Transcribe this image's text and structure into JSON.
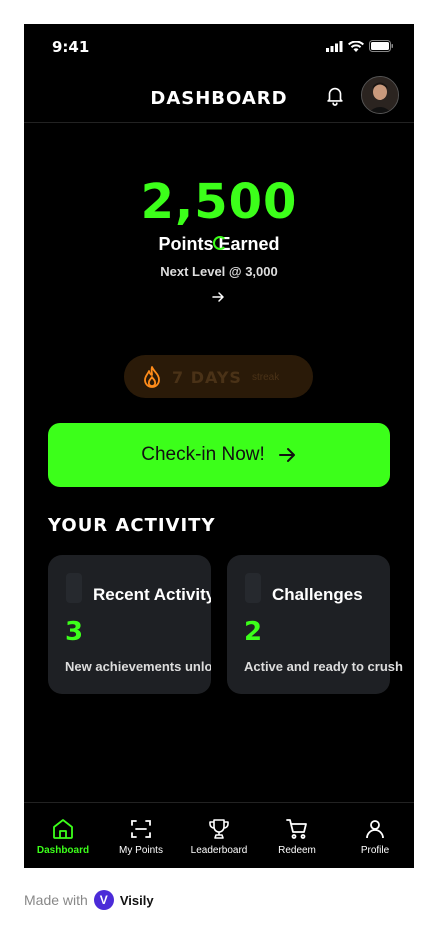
{
  "status_bar": {
    "time": "9:41"
  },
  "header": {
    "title": "DASHBOARD"
  },
  "summary": {
    "points": "2,500",
    "points_label": "Points Earned",
    "next_level": "Next Level @ 3,000"
  },
  "streak": {
    "text": "7 DAYS",
    "sub": "streak"
  },
  "checkin": {
    "label": "Check-in Now!"
  },
  "activity": {
    "title": "YOUR ACTIVITY",
    "cards": [
      {
        "title": "Recent Activity",
        "value": "3",
        "desc": "New achievements unlocked"
      },
      {
        "title": "Challenges",
        "value": "2",
        "desc": "Active and ready to crush"
      }
    ]
  },
  "nav": [
    {
      "label": "Dashboard",
      "icon": "home-icon",
      "active": true
    },
    {
      "label": "My Points",
      "icon": "scan-icon"
    },
    {
      "label": "Leaderboard",
      "icon": "trophy-icon"
    },
    {
      "label": "Redeem",
      "icon": "cart-icon"
    },
    {
      "label": "Profile",
      "icon": "user-icon"
    }
  ],
  "footer": {
    "text": "Made with",
    "brand": "Visily"
  },
  "colors": {
    "accent": "#3cff1a",
    "background": "#000000",
    "card": "#1e2024"
  }
}
